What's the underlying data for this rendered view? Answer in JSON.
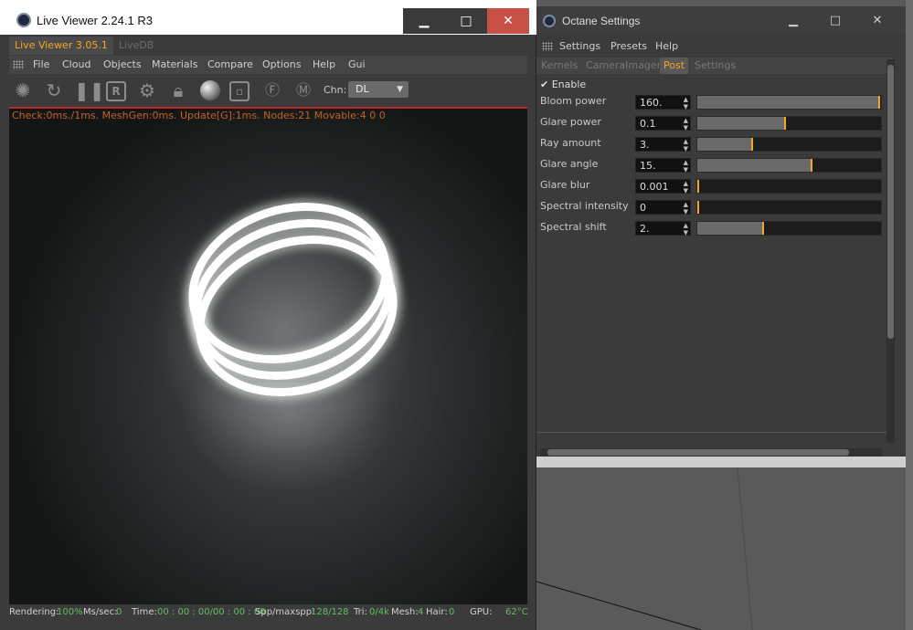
{
  "live_viewer": {
    "title": "Live Viewer 2.24.1 R3",
    "window_buttons": {
      "minimize": "▁",
      "maximize": "□",
      "close": "✕"
    },
    "tabs": [
      "Live Viewer 3.05.1",
      "LiveDB"
    ],
    "menu": [
      "File",
      "Cloud",
      "Objects",
      "Materials",
      "Compare",
      "Options",
      "Help",
      "Gui"
    ],
    "toolbar": {
      "channel_label": "Chn:",
      "channel_value": "DL",
      "icons": [
        "octane-logo-icon",
        "refresh-icon",
        "pause-icon",
        "r-icon",
        "gear-icon",
        "lock-icon",
        "material-sphere-icon",
        "region-icon",
        "focus-pick-icon",
        "material-pick-icon"
      ]
    },
    "status_top": "Check:0ms./1ms. MeshGen:0ms. Update[G]:1ms. Nodes:21 Movable:4  0 0",
    "statusbar": {
      "rendering_label": "Rendering:",
      "rendering_value": "100%",
      "mssec_label": "Ms/sec:",
      "mssec_value": "0",
      "time_label": "Time:",
      "time_value": "00 : 00 : 00/00 : 00 : 00",
      "spp_label": "Spp/maxspp:",
      "spp_value": "128/128",
      "tri_label": "Tri:",
      "tri_value": "0/4k",
      "mesh_label": "Mesh:",
      "mesh_value": "4",
      "hair_label": "Hair:",
      "hair_value": "0",
      "gpu_label": "GPU:",
      "gpu_value": "62°C"
    }
  },
  "octane_settings": {
    "title": "Octane Settings",
    "window_buttons": {
      "minimize": "▁",
      "maximize": "□",
      "close": "✕"
    },
    "menu": [
      "Settings",
      "Presets",
      "Help"
    ],
    "tabs": [
      "Kernels",
      "CameraImager",
      "Post",
      "Settings"
    ],
    "enable_label": "Enable",
    "params": [
      {
        "label": "Bloom power",
        "value": "160.",
        "level": 1.0
      },
      {
        "label": "Glare power",
        "value": "0.1",
        "level": 0.48
      },
      {
        "label": "Ray amount",
        "value": "3.",
        "level": 0.3
      },
      {
        "label": "Glare angle",
        "value": "15.",
        "level": 0.63
      },
      {
        "label": "Glare blur",
        "value": "0.001",
        "level": 0.0
      },
      {
        "label": "Spectral intensity",
        "value": "0",
        "level": 0.0
      },
      {
        "label": "Spectral shift",
        "value": "2.",
        "level": 0.36
      }
    ]
  },
  "colors": {
    "accent": "#f5a623",
    "status_value": "#5fbf5f",
    "status_warning": "#c0631e",
    "close_button": "#c84f45"
  }
}
